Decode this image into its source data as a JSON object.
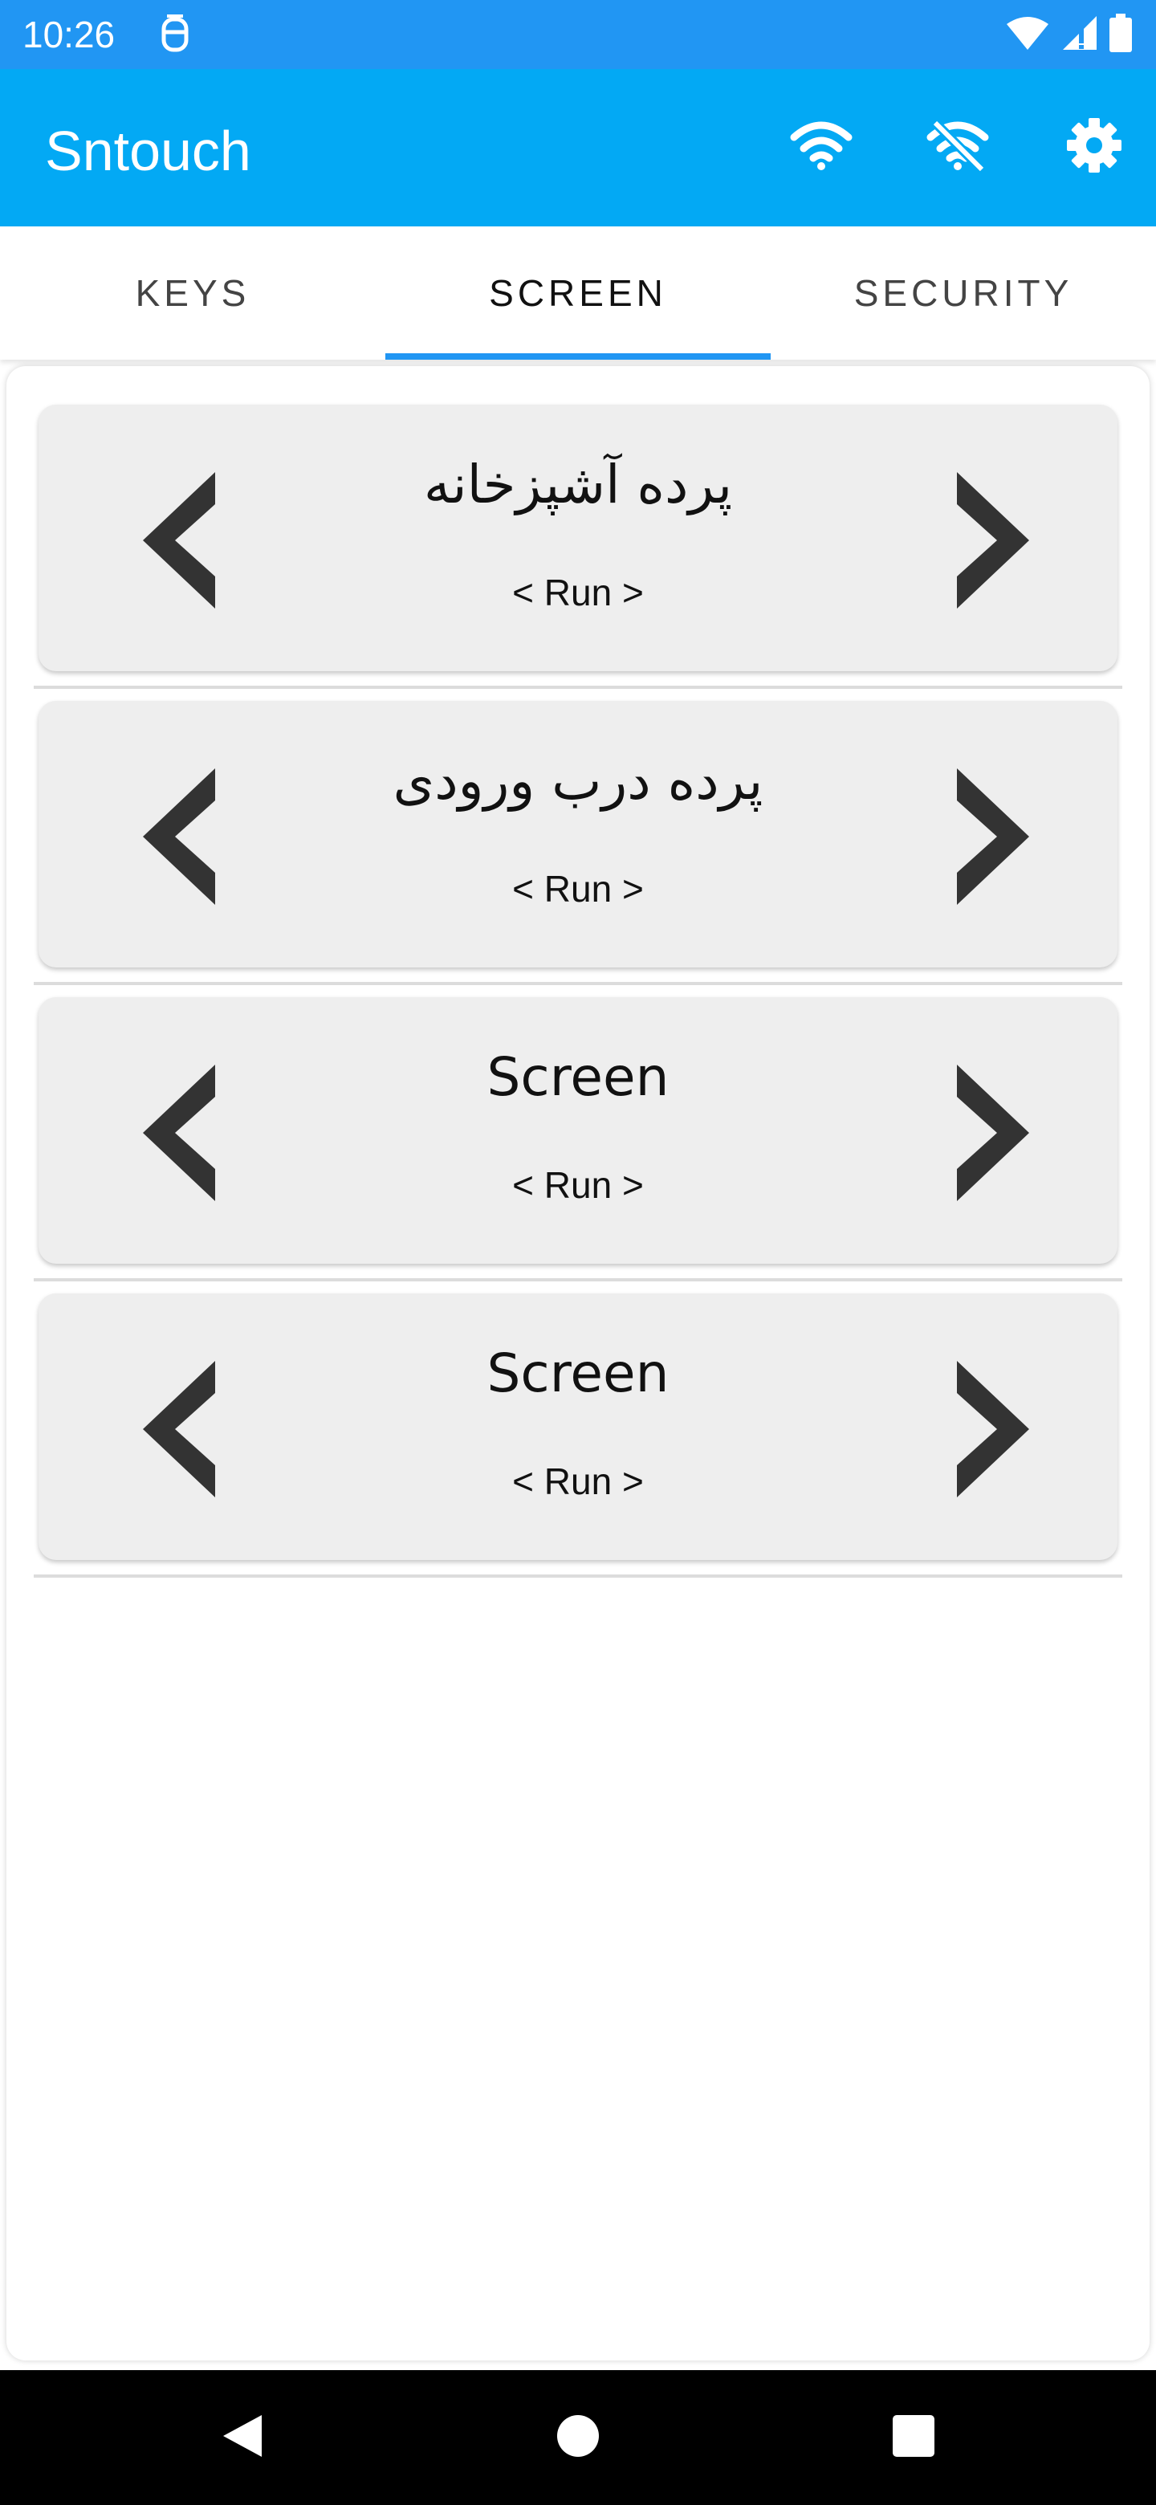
{
  "status_bar": {
    "time": "10:26",
    "icons": [
      "notification-icon",
      "wifi-signal-icon",
      "cell-signal-icon",
      "battery-icon"
    ]
  },
  "app_bar": {
    "title": "Sntouch",
    "actions": [
      "wifi-icon",
      "wifi-off-icon",
      "settings-icon"
    ],
    "color": "#03a9f4"
  },
  "tabs": [
    {
      "label": "KEYS",
      "active": false
    },
    {
      "label": "SCREEN",
      "active": true
    },
    {
      "label": "SECURITY",
      "active": false
    }
  ],
  "accent_color": "#2196f3",
  "screens": [
    {
      "title": "پرده آشپزخانه",
      "run_label": "< Run >"
    },
    {
      "title": "پرده درب ورودی",
      "run_label": "< Run >"
    },
    {
      "title": "Screen",
      "run_label": "< Run >"
    },
    {
      "title": "Screen",
      "run_label": "< Run >"
    }
  ],
  "nav_bar": {
    "buttons": [
      "back-icon",
      "home-icon",
      "recents-icon"
    ]
  }
}
